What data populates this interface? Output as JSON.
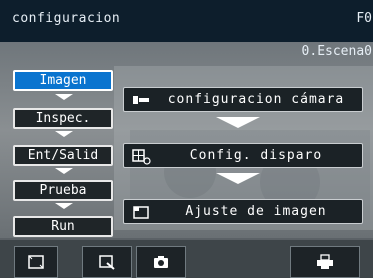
{
  "header": {
    "title": "configuracion",
    "function_code": "F0",
    "scene": "0.Escena0"
  },
  "sidebar": {
    "items": [
      {
        "label": "Imagen",
        "active": true
      },
      {
        "label": "Inspec.",
        "active": false
      },
      {
        "label": "Ent/Salid",
        "active": false
      },
      {
        "label": "Prueba",
        "active": false
      },
      {
        "label": "Run",
        "active": false
      }
    ]
  },
  "main": {
    "buttons": [
      {
        "label": "configuracion cámara",
        "icon": "camera-settings-icon"
      },
      {
        "label": "Config. disparo",
        "icon": "trigger-icon"
      },
      {
        "label": "Ajuste de imagen",
        "icon": "image-adjust-icon"
      }
    ]
  },
  "toolbar": {
    "buttons": [
      {
        "icon": "fit-screen-icon"
      },
      {
        "icon": "zoom-icon"
      },
      {
        "icon": "camera-capture-icon"
      },
      {
        "icon": "print-icon"
      }
    ]
  },
  "colors": {
    "titlebar_bg": "#0d1e2c",
    "active_tab": "#0a74cf",
    "button_bg": "#1b2226"
  }
}
